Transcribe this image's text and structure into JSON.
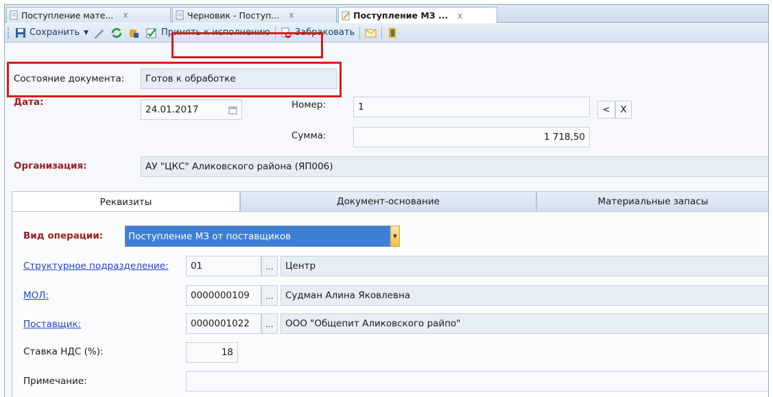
{
  "tabs": [
    {
      "label": "Поступление мате...",
      "close": "x"
    },
    {
      "label": "Черновик - Поступ...",
      "close": "x"
    },
    {
      "label": "Поступление МЗ ...",
      "close": "x"
    }
  ],
  "toolbar": {
    "save_label": "Сохранить",
    "accept_label": "Принять к исполнению",
    "reject_label": "Забраковать"
  },
  "header": {
    "state_label": "Состояние документа:",
    "state_value": "Готов к обработке",
    "date_label": "Дата:",
    "date_value": "24.01.2017",
    "number_label": "Номер:",
    "number_value": "1",
    "nav_prev": "<",
    "nav_clear": "X",
    "sum_label": "Сумма:",
    "sum_value": "1 718,50",
    "org_label": "Организация:",
    "org_value": "АУ \"ЦКС\" Аликовского района (ЯП006)"
  },
  "form_tabs": [
    {
      "label": "Реквизиты",
      "active": true
    },
    {
      "label": "Документ-основание",
      "active": false
    },
    {
      "label": "Материальные запасы",
      "active": false
    }
  ],
  "details": {
    "op_label": "Вид операции:",
    "op_value": "Поступление МЗ от поставщиков",
    "dept_label": "Структурное подразделение:",
    "dept_code": "01",
    "dept_name": "Центр",
    "mol_label": "МОЛ:",
    "mol_code": "0000000109",
    "mol_name": "Судман Алина Яковлевна",
    "supplier_label": "Поставщик:",
    "supplier_code": "0000001022",
    "supplier_name": "ООО  \"Общепит Аликовского райпо\"",
    "vat_label": "Ставка НДС (%):",
    "vat_value": "18",
    "note_label": "Примечание:",
    "note_value": "",
    "dots": "..."
  },
  "colors": {
    "highlight": "#d7191c",
    "required_label": "#9b1c1c",
    "link": "#1f3fd6",
    "selected": "#3d7fd4"
  }
}
